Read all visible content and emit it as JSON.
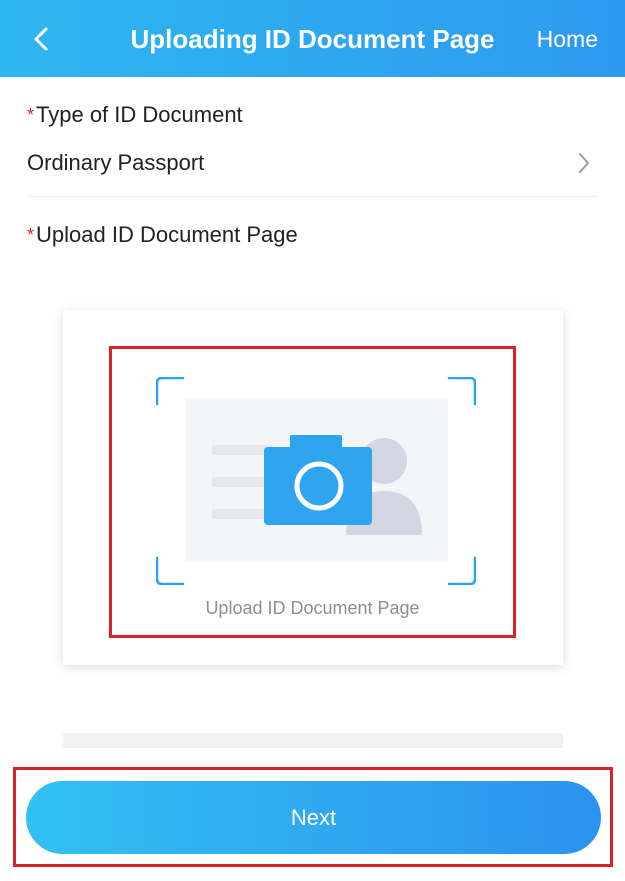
{
  "header": {
    "title": "Uploading ID Document Page",
    "home_label": "Home",
    "back_icon": "chevron-left-icon",
    "background": "#2d9af0"
  },
  "form": {
    "doc_type": {
      "required_mark": "*",
      "label": "Type of ID Document",
      "value": "Ordinary Passport",
      "icon": "chevron-right-icon"
    },
    "upload": {
      "required_mark": "*",
      "label": "Upload ID Document Page",
      "caption": "Upload ID Document Page",
      "icon": "camera-icon"
    }
  },
  "next_button": {
    "label": "Next"
  },
  "colors": {
    "accent": "#2d9af0",
    "required": "#e02020",
    "highlight": "#d8232a"
  }
}
